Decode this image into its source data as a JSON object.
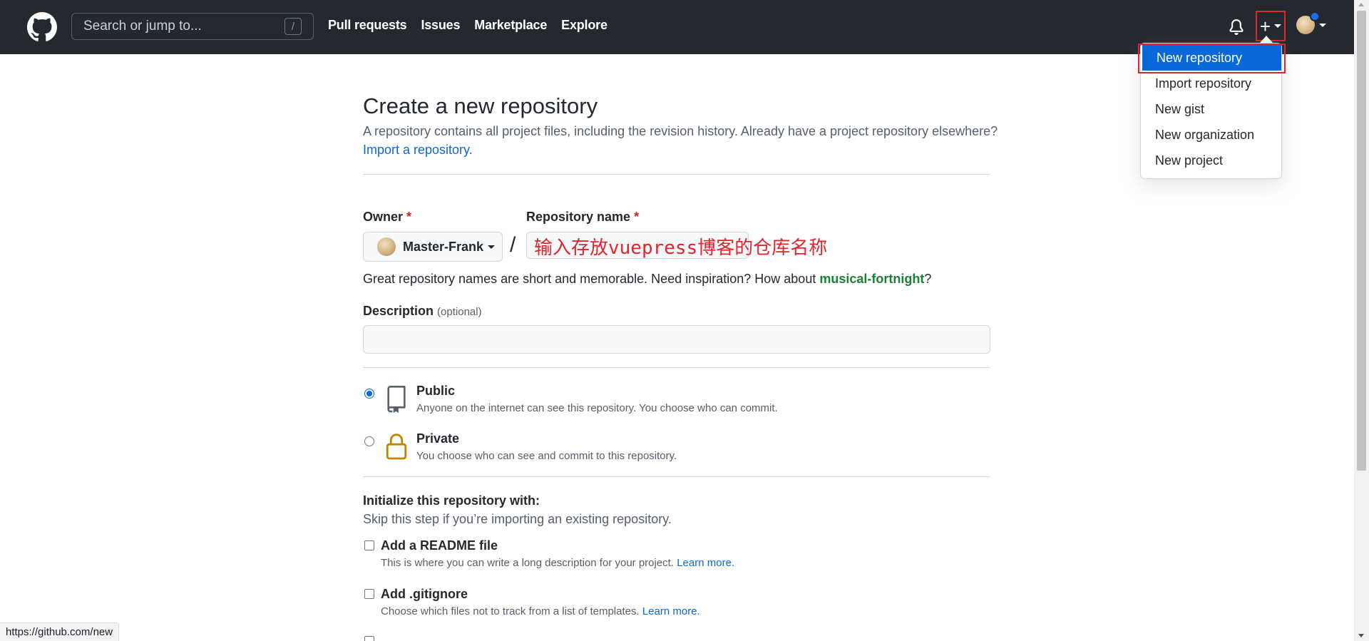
{
  "header": {
    "search_placeholder": "Search or jump to...",
    "search_shortcut": "/",
    "nav": [
      "Pull requests",
      "Issues",
      "Marketplace",
      "Explore"
    ],
    "plus_glyph": "+",
    "icons": {
      "logo": "github-logo-icon",
      "bell": "bell-icon",
      "plus": "plus-icon",
      "avatar": "avatar"
    }
  },
  "new_menu": {
    "items": [
      "New repository",
      "Import repository",
      "New gist",
      "New organization",
      "New project"
    ],
    "active_index": 0
  },
  "page": {
    "title": "Create a new repository",
    "subtitle": "A repository contains all project files, including the revision history. Already have a project repository elsewhere?",
    "import_link": "Import a repository.",
    "owner_label": "Owner",
    "required_mark": "*",
    "owner_name": "Master-Frank",
    "slash": "/",
    "repo_name_label": "Repository name",
    "annotation": "输入存放vuepress博客的仓库名称",
    "hint_prefix": "Great repository names are short and memorable. Need inspiration? How about ",
    "hint_suggestion": "musical-fortnight",
    "hint_suffix": "?",
    "description_label": "Description",
    "description_optional": "(optional)",
    "visibility": [
      {
        "title": "Public",
        "desc": "Anyone on the internet can see this repository. You choose who can commit.",
        "checked": true,
        "icon": "repo-icon"
      },
      {
        "title": "Private",
        "desc": "You choose who can see and commit to this repository.",
        "checked": false,
        "icon": "lock-icon"
      }
    ],
    "init_title": "Initialize this repository with:",
    "init_sub": "Skip this step if you’re importing an existing repository.",
    "init_options": [
      {
        "title": "Add a README file",
        "desc": "This is where you can write a long description for your project.",
        "link": "Learn more."
      },
      {
        "title": "Add .gitignore",
        "desc": "Choose which files not to track from a list of templates.",
        "link": "Learn more."
      }
    ]
  },
  "status_url": "https://github.com/new",
  "colors": {
    "header_bg": "#24292f",
    "accent_blue": "#0969da",
    "annotation_red": "#e5232a",
    "suggest_green": "#1a7f37",
    "private_icon": "#bf8700"
  }
}
